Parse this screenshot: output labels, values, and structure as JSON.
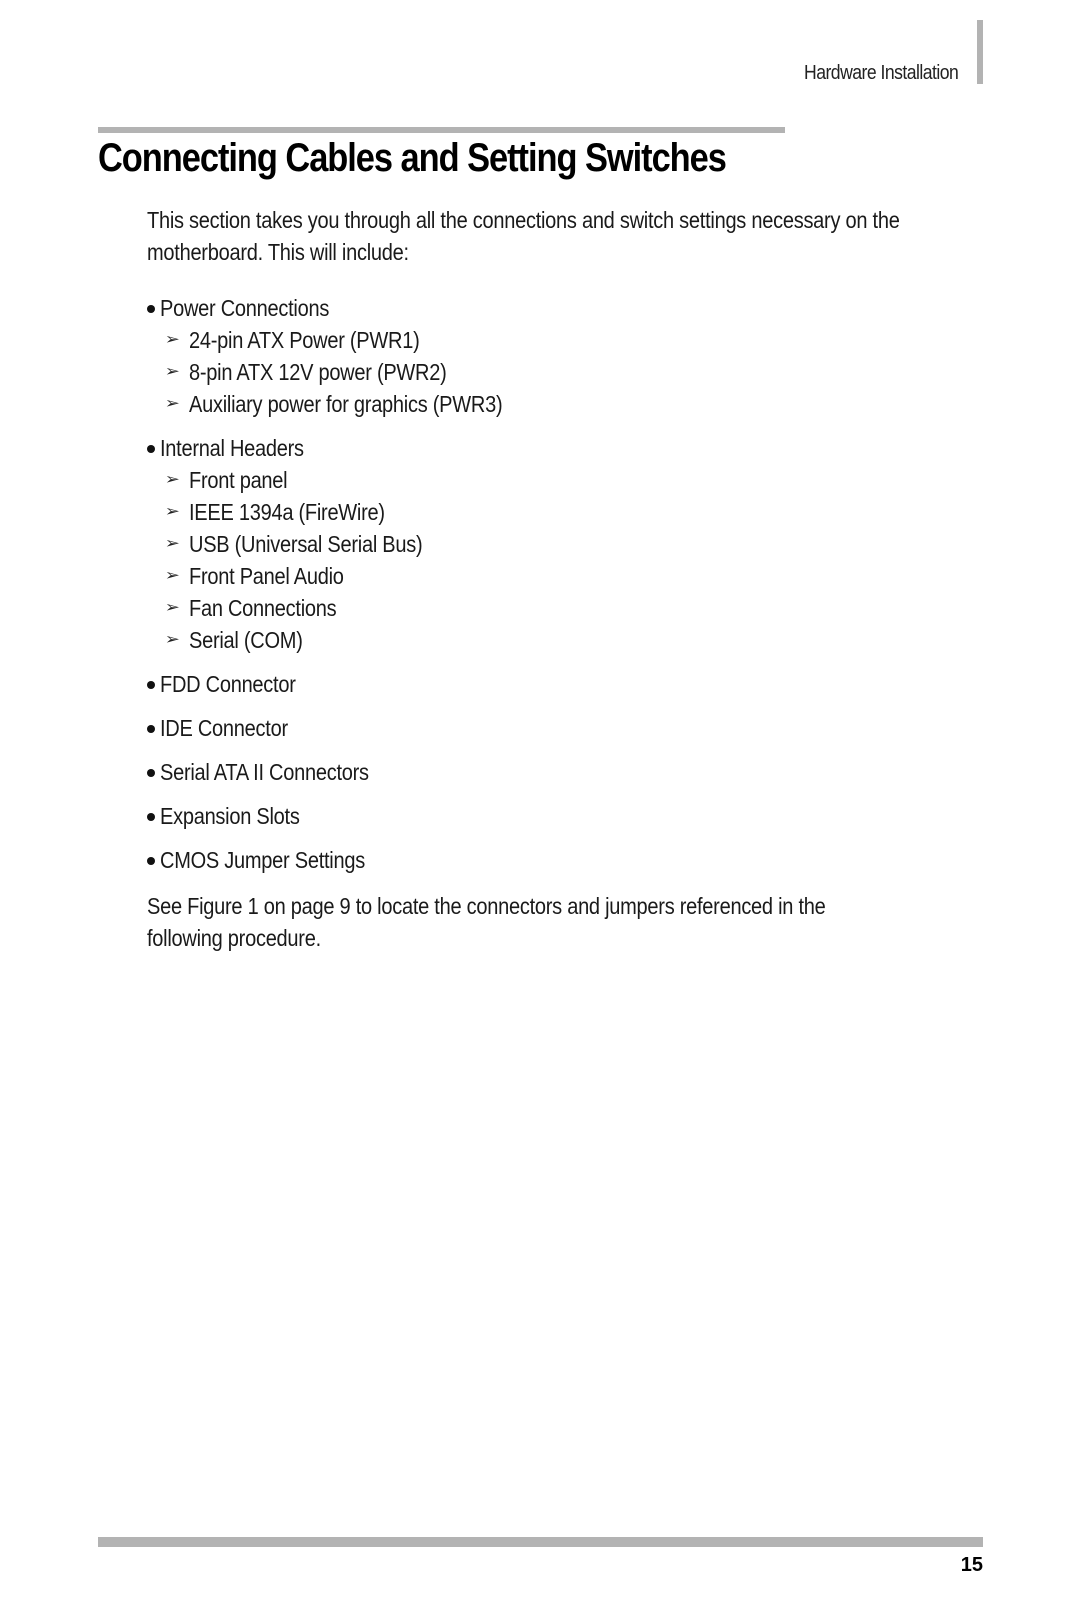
{
  "header": {
    "section_label": "Hardware Installation"
  },
  "title": "Connecting Cables and Setting Switches",
  "intro": [
    "This section takes you through all the connections and switch settings necessary on the",
    "motherboard. This will include:"
  ],
  "bullet_icon": "bullet-dot",
  "sub_icon": "arrowhead-right",
  "groups": [
    {
      "label": "Power Connections",
      "items": [
        "24-pin ATX Power (PWR1)",
        "8-pin ATX 12V power (PWR2)",
        "Auxiliary power for graphics (PWR3)"
      ]
    },
    {
      "label": "Internal Headers",
      "items": [
        "Front panel",
        "IEEE 1394a (FireWire)",
        "USB (Universal Serial Bus)",
        "Front Panel Audio",
        "Fan Connections",
        "Serial (COM)"
      ]
    },
    {
      "label": "FDD Connector",
      "items": []
    },
    {
      "label": "IDE Connector",
      "items": []
    },
    {
      "label": "Serial ATA II Connectors",
      "items": []
    },
    {
      "label": "Expansion Slots",
      "items": []
    },
    {
      "label": "CMOS Jumper Settings",
      "items": []
    }
  ],
  "closing": [
    "See Figure 1 on page 9 to locate the connectors and jumpers referenced in the",
    "following procedure."
  ],
  "footer": {
    "page_number": "15"
  }
}
